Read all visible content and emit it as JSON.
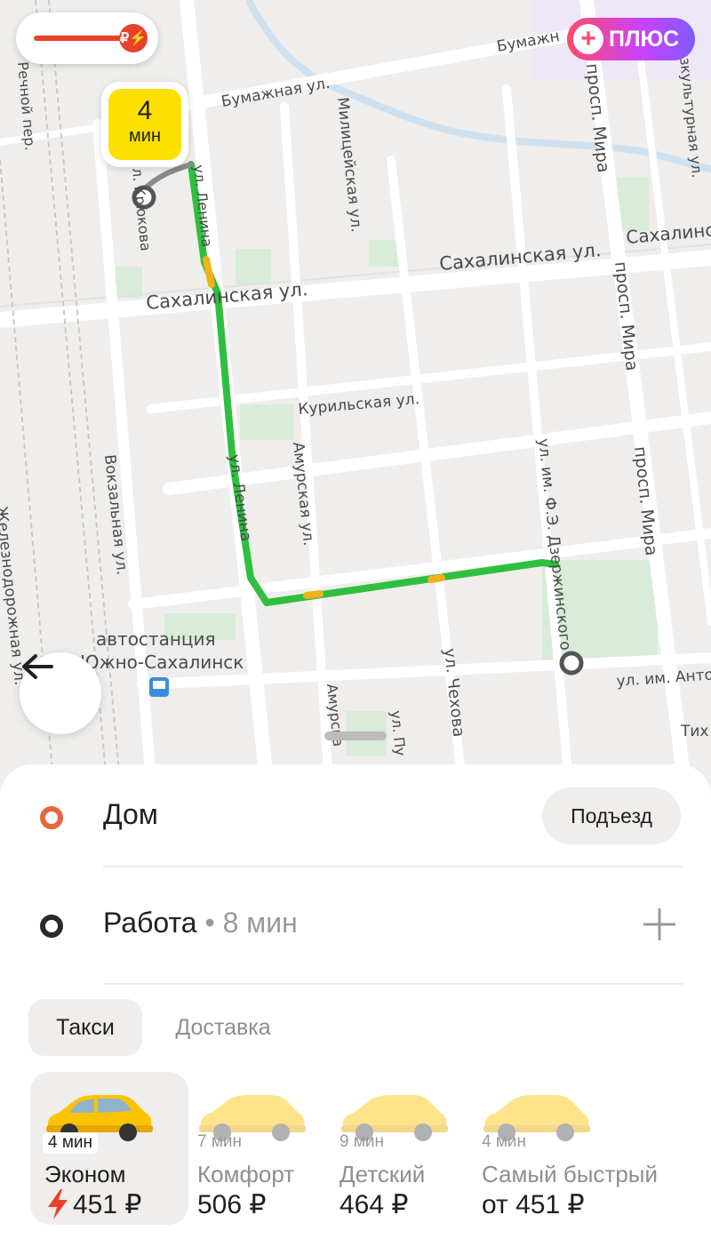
{
  "map": {
    "streets": {
      "bumazhnaya": "Бумажная ул.",
      "bumazhnaya_right": "Бумажн",
      "rechnoy": "Речной пер.",
      "militseyskaya": "Милицейская ул.",
      "mira_top": "просп. Мира",
      "mira_mid": "просп. Мира",
      "mira_bottom": "просп. Мира",
      "fizkultur": "изкультурная ул.",
      "krukova": "ул. Крюкова",
      "lenina_top": "ул. Ленина",
      "lenina_mid": "ул. Ленина",
      "sakh_left": "Сахалинская ул.",
      "sakh_mid": "Сахалинская ул.",
      "sakh_right": "Сахалинс",
      "kurilskaya": "Курильская ул.",
      "amurskaya": "Амурская ул.",
      "amurskaya_bottom": "Амурска",
      "vokzalnaya": "Вокзальная ул.",
      "dzerzhinskogo": "ул. им. Ф.Э. Дзержинского",
      "chekhova": "ул. Чехова",
      "pu": "ул. Пу",
      "anto": "ул. им. Анто",
      "tikh": "Тих",
      "zheleznodor": "Железнодорожная ул.",
      "busstation_1": "автостанция",
      "busstation_2": "Южно-Сахалинск"
    },
    "surge_symbol": "₽⚡",
    "plus_label": "ПЛЮС",
    "plus_symbol": "+",
    "eta_value": "4",
    "eta_unit": "мин",
    "back_symbol": "←"
  },
  "route": {
    "from": {
      "label": "Дом",
      "action": "Подъезд"
    },
    "to": {
      "label": "Работа",
      "duration": " • 8 мин",
      "add_symbol": "+"
    }
  },
  "tabs": [
    {
      "label": "Такси",
      "active": true
    },
    {
      "label": "Доставка",
      "active": false
    }
  ],
  "tariffs": [
    {
      "eta": "4 мин",
      "name": "Эконом",
      "price": "451 ₽",
      "surge": true,
      "selected": true
    },
    {
      "eta": "7 мин",
      "name": "Комфорт",
      "price": "506 ₽",
      "surge": false,
      "selected": false
    },
    {
      "eta": "9 мин",
      "name": "Детский",
      "price": "464 ₽",
      "surge": false,
      "selected": false
    },
    {
      "eta": "4 мин",
      "name": "Самый быстрый",
      "price": "от 451 ₽",
      "surge": false,
      "selected": false
    }
  ],
  "colors": {
    "route_green": "#2fbf3f",
    "route_yellow": "#f0b21c",
    "accent_yellow": "#fce000",
    "surge_red": "#e8412b",
    "from_orange": "#e8663c"
  }
}
